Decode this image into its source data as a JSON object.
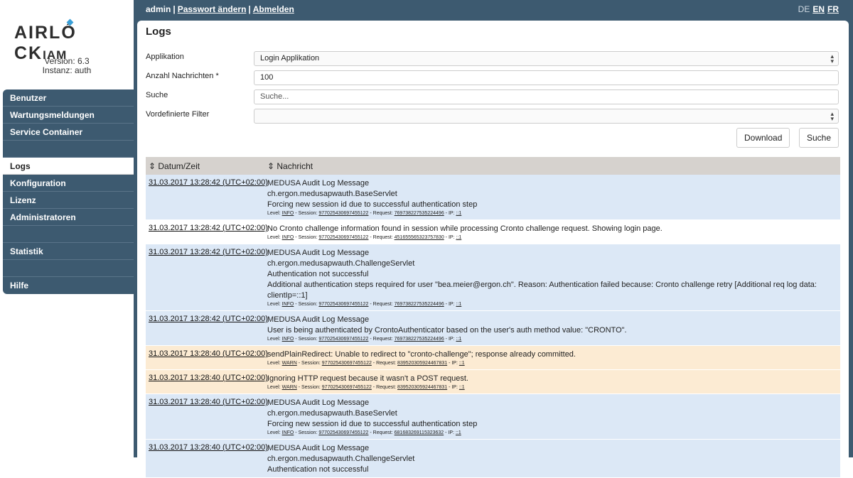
{
  "topbar": {
    "user": "admin",
    "change_password": "Passwort ändern",
    "logout": "Abmelden",
    "languages": [
      {
        "code": "DE",
        "active": true
      },
      {
        "code": "EN",
        "active": false
      },
      {
        "code": "FR",
        "active": false
      }
    ]
  },
  "sidebar": {
    "logo_text": "AIRLOCK",
    "logo_suffix": "IAM",
    "version": "Version: 6.3",
    "instance": "Instanz: auth",
    "nav_group1": [
      "Benutzer",
      "Wartungsmeldungen",
      "Service Container"
    ],
    "nav_group2": [
      "Logs",
      "Konfiguration",
      "Lizenz",
      "Administratoren"
    ],
    "nav_group3": [
      "Statistik"
    ],
    "nav_group4": [
      "Hilfe"
    ],
    "active_item": "Logs"
  },
  "page": {
    "title": "Logs",
    "form": {
      "application_label": "Applikation",
      "application_value": "Login Applikation",
      "count_label": "Anzahl Nachrichten *",
      "count_value": "100",
      "search_label": "Suche",
      "search_placeholder": "Suche...",
      "filter_label": "Vordefinierte Filter",
      "filter_value": ""
    },
    "buttons": {
      "download": "Download",
      "search": "Suche"
    },
    "table": {
      "col_date": "⇕ Datum/Zeit",
      "col_message": "⇕ Nachricht",
      "rows": [
        {
          "level": "info",
          "date": "31.03.2017 13:28:42 (UTC+02:00)",
          "lines": [
            "MEDUSA Audit Log Message",
            "ch.ergon.medusapwauth.BaseServlet",
            "Forcing new session id due to successful authentication step"
          ],
          "meta": {
            "level": "INFO",
            "session": "977025430697455122",
            "request": "769738227535224496",
            "ip": "::1"
          }
        },
        {
          "level": "info-white",
          "date": "31.03.2017 13:28:42 (UTC+02:00)",
          "lines": [
            "No Cronto challenge information found in session while processing Cronto challenge request. Showing login page."
          ],
          "meta": {
            "level": "INFO",
            "session": "977025430697455122",
            "request": "451655565323757830",
            "ip": "::1"
          }
        },
        {
          "level": "info",
          "date": "31.03.2017 13:28:42 (UTC+02:00)",
          "lines": [
            "MEDUSA Audit Log Message",
            "ch.ergon.medusapwauth.ChallengeServlet",
            "Authentication not successful",
            "Additional authentication steps required for user \"bea.meier@ergon.ch\". Reason: Authentication failed because: Cronto challenge retry [Additional req log data: clientIp=::1]"
          ],
          "meta": {
            "level": "INFO",
            "session": "977025430697455122",
            "request": "769738227535224496",
            "ip": "::1"
          }
        },
        {
          "level": "info",
          "date": "31.03.2017 13:28:42 (UTC+02:00)",
          "lines": [
            "MEDUSA Audit Log Message",
            "User is being authenticated by CrontoAuthenticator based on the user's auth method value: \"CRONTO\"."
          ],
          "meta": {
            "level": "INFO",
            "session": "977025430697455122",
            "request": "769738227535224496",
            "ip": "::1"
          }
        },
        {
          "level": "warn",
          "date": "31.03.2017 13:28:40 (UTC+02:00)",
          "lines": [
            "sendPlainRedirect: Unable to redirect to \"cronto-challenge\"; response already committed."
          ],
          "meta": {
            "level": "WARN",
            "session": "977025430697455122",
            "request": "839520305924467831",
            "ip": "::1"
          }
        },
        {
          "level": "warn",
          "date": "31.03.2017 13:28:40 (UTC+02:00)",
          "lines": [
            "Ignoring HTTP request because it wasn't a POST request."
          ],
          "meta": {
            "level": "WARN",
            "session": "977025430697455122",
            "request": "839520305924467831",
            "ip": "::1"
          }
        },
        {
          "level": "info",
          "date": "31.03.2017 13:28:40 (UTC+02:00)",
          "lines": [
            "MEDUSA Audit Log Message",
            "ch.ergon.medusapwauth.BaseServlet",
            "Forcing new session id due to successful authentication step"
          ],
          "meta": {
            "level": "INFO",
            "session": "977025430697455122",
            "request": "681683269115323632",
            "ip": "::1"
          }
        },
        {
          "level": "info",
          "date": "31.03.2017 13:28:40 (UTC+02:00)",
          "lines": [
            "MEDUSA Audit Log Message",
            "ch.ergon.medusapwauth.ChallengeServlet",
            "Authentication not successful"
          ],
          "meta": null
        }
      ]
    }
  },
  "colors": {
    "brand_dark": "#3d5a70",
    "row_info": "#dce8f6",
    "row_warn": "#fcebd3",
    "table_header": "#d6d2ce"
  }
}
